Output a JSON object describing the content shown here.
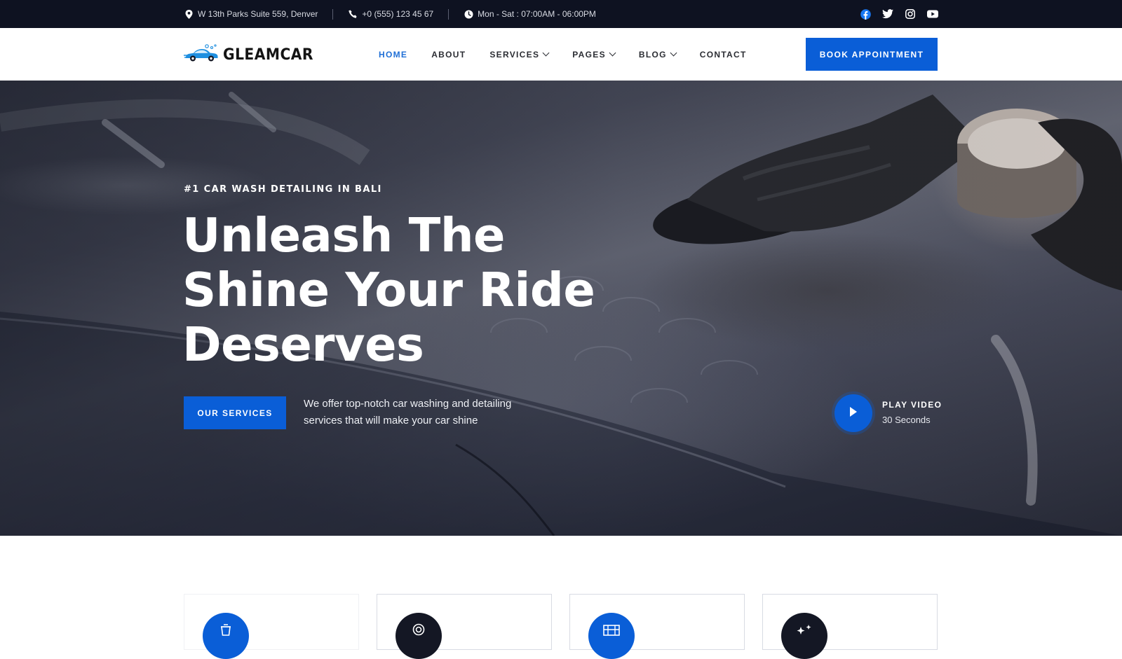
{
  "topbar": {
    "address": "W 13th Parks Suite 559, Denver",
    "phone": "+0 (555) 123 45 67",
    "hours": "Mon - Sat : 07:00AM - 06:00PM",
    "social": [
      "facebook-icon",
      "twitter-icon",
      "instagram-icon",
      "youtube-icon"
    ]
  },
  "brand": {
    "name": "GLEAMCAR"
  },
  "nav": {
    "items": [
      {
        "label": "HOME",
        "active": true
      },
      {
        "label": "ABOUT"
      },
      {
        "label": "SERVICES",
        "dropdown": true
      },
      {
        "label": "PAGES",
        "dropdown": true
      },
      {
        "label": "BLOG",
        "dropdown": true
      },
      {
        "label": "CONTACT"
      }
    ],
    "book_label": "BOOK APPOINTMENT"
  },
  "hero": {
    "eyebrow": "#1 CAR WASH DETAILING IN BALI",
    "headline_line1": "Unleash The",
    "headline_line2": "Shine Your Ride",
    "headline_line3": "Deserves",
    "cta_label": "OUR SERVICES",
    "description": "We offer top-notch car washing and detailing services that will make your car shine",
    "play_title": "PLAY VIDEO",
    "play_subtitle": "30 Seconds"
  },
  "cards": [
    {
      "icon": "bucket-icon",
      "color": "#0a5ed7"
    },
    {
      "icon": "tire-icon",
      "color": "#141724"
    },
    {
      "icon": "car-wash-icon",
      "color": "#0a5ed7"
    },
    {
      "icon": "sparkle-icon",
      "color": "#141724"
    }
  ],
  "colors": {
    "accent": "#0a5ed7",
    "topbar_bg": "#0e1221",
    "dark_circle": "#141724"
  }
}
